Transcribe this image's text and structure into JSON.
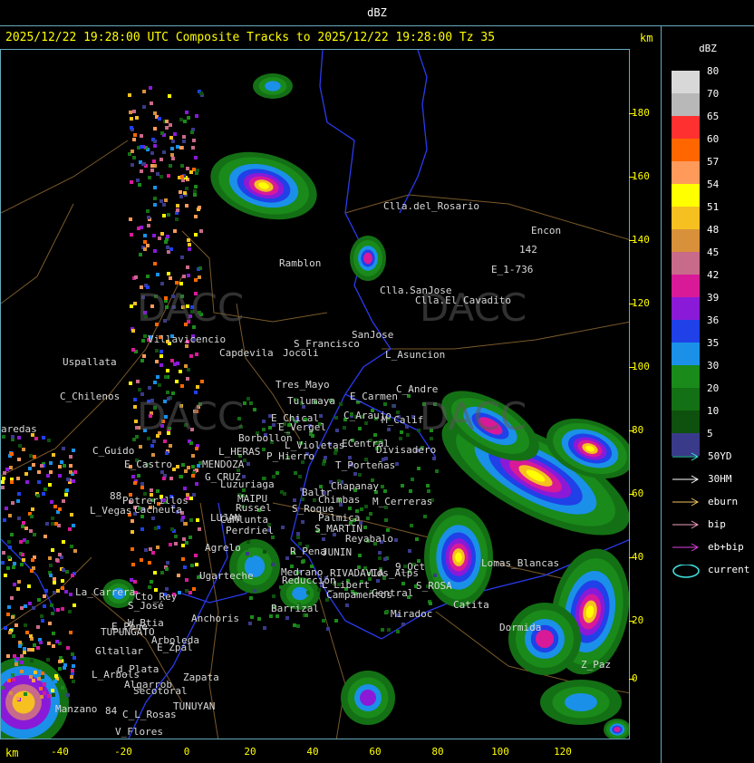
{
  "header": {
    "title": "dBZ"
  },
  "subtitle": "2025/12/22 19:28:00 UTC Composite Tracks to 2025/12/22 19:28:00 Tz 35",
  "axis": {
    "unit_top": "km",
    "unit_bottom": "km",
    "y_ticks": [
      "180",
      "160",
      "140",
      "120",
      "100",
      "80",
      "60",
      "40",
      "20",
      "0"
    ],
    "x_ticks": [
      "-40",
      "-20",
      "0",
      "20",
      "40",
      "60",
      "80",
      "100",
      "120"
    ]
  },
  "legend": {
    "title": "dBZ",
    "scale": [
      {
        "label": "80",
        "color": "#d8d8d8"
      },
      {
        "label": "70",
        "color": "#b8b8b8"
      },
      {
        "label": "65",
        "color": "#ff3030"
      },
      {
        "label": "60",
        "color": "#ff6600"
      },
      {
        "label": "57",
        "color": "#ff9a5a"
      },
      {
        "label": "54",
        "color": "#ffff00"
      },
      {
        "label": "51",
        "color": "#f5c020"
      },
      {
        "label": "48",
        "color": "#d8903a"
      },
      {
        "label": "45",
        "color": "#c86a8a"
      },
      {
        "label": "42",
        "color": "#d81a98"
      },
      {
        "label": "39",
        "color": "#8a1ad8"
      },
      {
        "label": "36",
        "color": "#2040e8"
      },
      {
        "label": "35",
        "color": "#1a90e8"
      },
      {
        "label": "30",
        "color": "#1a8a1a"
      },
      {
        "label": "20",
        "color": "#147014"
      },
      {
        "label": "10",
        "color": "#0e500e"
      },
      {
        "label": "5",
        "color": "#3a3a8a"
      }
    ],
    "tracks": [
      {
        "label": "50YD",
        "color": "#40e0e0"
      },
      {
        "label": "30HM",
        "color": "#ffffff"
      },
      {
        "label": "eburn",
        "color": "#f0c060"
      },
      {
        "label": "bip",
        "color": "#f0a0c0"
      },
      {
        "label": "eb+bip",
        "color": "#e040e0"
      },
      {
        "label": "current",
        "color": "#40e0e0"
      }
    ]
  },
  "watermark": {
    "brand": "DACC"
  },
  "places": [
    "Clla.del_Rosario",
    "Encon",
    "142",
    "E_1-736",
    "Ramblon",
    "Clla.SanJose",
    "Clla.El_Cavadito",
    "Villavicencio",
    "Capdevila",
    "Jocoli",
    "S_Francisco",
    "SanJose",
    "L_Asuncion",
    "Uspallata",
    "C_Chilenos",
    "Tres_Mayo",
    "Tulumaya",
    "C_Andre",
    "E_Carmen",
    "E_Chical",
    "E_Vergel",
    "C_Araujo",
    "M_Calif",
    "Borbollon",
    "L_Violetas",
    "ECentral",
    "Divisadero",
    "aredas",
    "C_Guido",
    "L_HERAS",
    "P_Hierro",
    "E_Castro",
    "MENDOZA",
    "T_Porteñas",
    "G_CRUZ",
    "Luzuriaga",
    "Chapanay",
    "Baltr",
    "Chimbas",
    "M_Cerreras",
    "MAIPU",
    "Russel",
    "Potrerillos",
    "Cacheuta",
    "L_Vegas",
    "S_Roque",
    "Palmica",
    "LUJAN",
    "CuMlunta",
    "S_MARTIN",
    "Perdriel",
    "Reyabalo",
    "Agrelo",
    "R_Pena",
    "JUNIN",
    "9_Oct",
    "Ugarteche",
    "Lomas_Blancas",
    "Medrano",
    "Reducción",
    "RIVADAVIA",
    "Los_Alps",
    "La_Carrera",
    "Cto_Rey",
    "S_José",
    "L_Libert",
    "S_ROSA",
    "Campamentos",
    "Central",
    "Barrizal",
    "Anchoris",
    "W_Btia",
    "TUPUNGATO",
    "Catita",
    "Miradoc",
    "Arboleda",
    "Dormida",
    "Gltallar",
    "E_Zpal",
    "d_Plata",
    "Z_Paz",
    "L_Arbols",
    "Zapata",
    "Algarrob",
    "Secotoral",
    "TUNUYAN",
    "C_L_Rosas",
    "Manzano",
    "V_Flores",
    "88",
    "84",
    "E_Pene"
  ]
}
